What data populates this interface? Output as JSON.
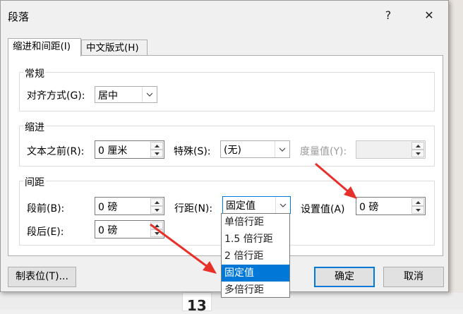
{
  "background": {
    "page_number": "13"
  },
  "dialog": {
    "title": "段落",
    "help_label": "?",
    "close_label": "✕",
    "tabs": [
      {
        "label": "缩进和间距(I)",
        "active": true
      },
      {
        "label": "中文版式(H)",
        "active": false
      }
    ],
    "general": {
      "title": "常规",
      "alignment_label": "对齐方式(G):",
      "alignment_value": "居中"
    },
    "indent": {
      "title": "缩进",
      "before_text_label": "文本之前(R):",
      "before_text_value": "0 厘米",
      "special_label": "特殊(S):",
      "special_value": "(无)",
      "measure_label": "度量值(Y):",
      "measure_value": ""
    },
    "spacing": {
      "title": "间距",
      "before_label": "段前(B):",
      "before_value": "0 磅",
      "after_label": "段后(E):",
      "after_value": "0 磅",
      "line_spacing_label": "行距(N):",
      "line_spacing_value": "固定值",
      "set_value_label": "设置值(A)",
      "set_value": "0 磅",
      "line_spacing_options": [
        "单倍行距",
        "1.5 倍行距",
        "2 倍行距",
        "固定值",
        "多倍行距"
      ],
      "selected_option": "固定值"
    },
    "buttons": {
      "tabs_label": "制表位(T)...",
      "ok_label": "确定",
      "cancel_label": "取消"
    }
  },
  "colors": {
    "accent": "#0078d7",
    "annotation_arrow": "#e8302a"
  }
}
